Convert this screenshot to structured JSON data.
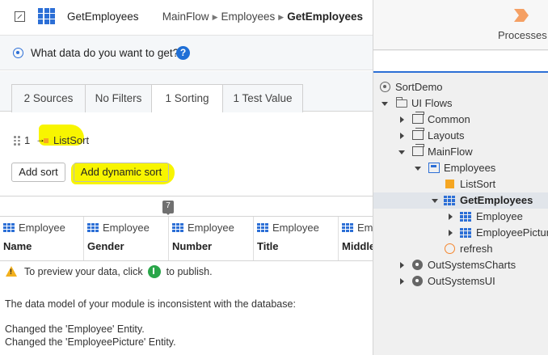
{
  "header": {
    "title": "GetEmployees",
    "breadcrumb": [
      "MainFlow",
      "Employees",
      "GetEmployees"
    ],
    "breadcrumb_sep": "▶"
  },
  "question": {
    "text": "What data do you want to get?",
    "help": "?"
  },
  "tabs": [
    {
      "label": "2 Sources",
      "active": false
    },
    {
      "label": "No Filters",
      "active": false
    },
    {
      "label": "1 Sorting",
      "active": true
    },
    {
      "label": "1 Test Value",
      "active": false
    }
  ],
  "sorting": {
    "index": "1",
    "item": "ListSort",
    "add_sort_label": "Add sort",
    "add_dynamic_sort_label": "Add dynamic sort"
  },
  "preview": {
    "count_badge": "7",
    "columns": [
      {
        "type": "Employee",
        "name": "Name"
      },
      {
        "type": "Employee",
        "name": "Gender"
      },
      {
        "type": "Employee",
        "name": "Number"
      },
      {
        "type": "Employee",
        "name": "Title"
      },
      {
        "type": "Em",
        "name": "Middle"
      }
    ],
    "warning_before": "To preview your data, click",
    "warning_after": "to publish.",
    "messages": [
      "The data model of your module is inconsistent with the database:",
      "Changed the 'Employee' Entity.",
      "Changed the 'EmployeePicture' Entity."
    ]
  },
  "right_panel": {
    "processes_label": "Processes",
    "tree": [
      {
        "label": "SortDemo",
        "icon": "module-icon",
        "expander": "none"
      },
      {
        "label": "UI Flows",
        "icon": "folder-icon",
        "expander": "down"
      },
      {
        "label": "Common",
        "icon": "flow-icon",
        "expander": "right"
      },
      {
        "label": "Layouts",
        "icon": "flow-icon",
        "expander": "right"
      },
      {
        "label": "MainFlow",
        "icon": "flow-icon",
        "expander": "down"
      },
      {
        "label": "Employees",
        "icon": "screen-icon",
        "expander": "down"
      },
      {
        "label": "ListSort",
        "icon": "sort-variable-icon",
        "expander": "none"
      },
      {
        "label": "GetEmployees",
        "icon": "aggregate-icon",
        "expander": "down",
        "selected": true
      },
      {
        "label": "Employee",
        "icon": "entity-icon",
        "expander": "right"
      },
      {
        "label": "EmployeePicture",
        "icon": "entity-icon",
        "expander": "right"
      },
      {
        "label": "refresh",
        "icon": "screen-action-icon",
        "expander": "none"
      },
      {
        "label": "OutSystemsCharts",
        "icon": "module-ref-icon",
        "expander": "right"
      },
      {
        "label": "OutSystemsUI",
        "icon": "module-ref-icon",
        "expander": "right"
      }
    ]
  },
  "colors": {
    "accent": "#2c6fd6",
    "highlight": "#f8f500",
    "sort_variable": "#f5a623",
    "publish": "#2aa64a",
    "warning": "#f2b01e"
  }
}
